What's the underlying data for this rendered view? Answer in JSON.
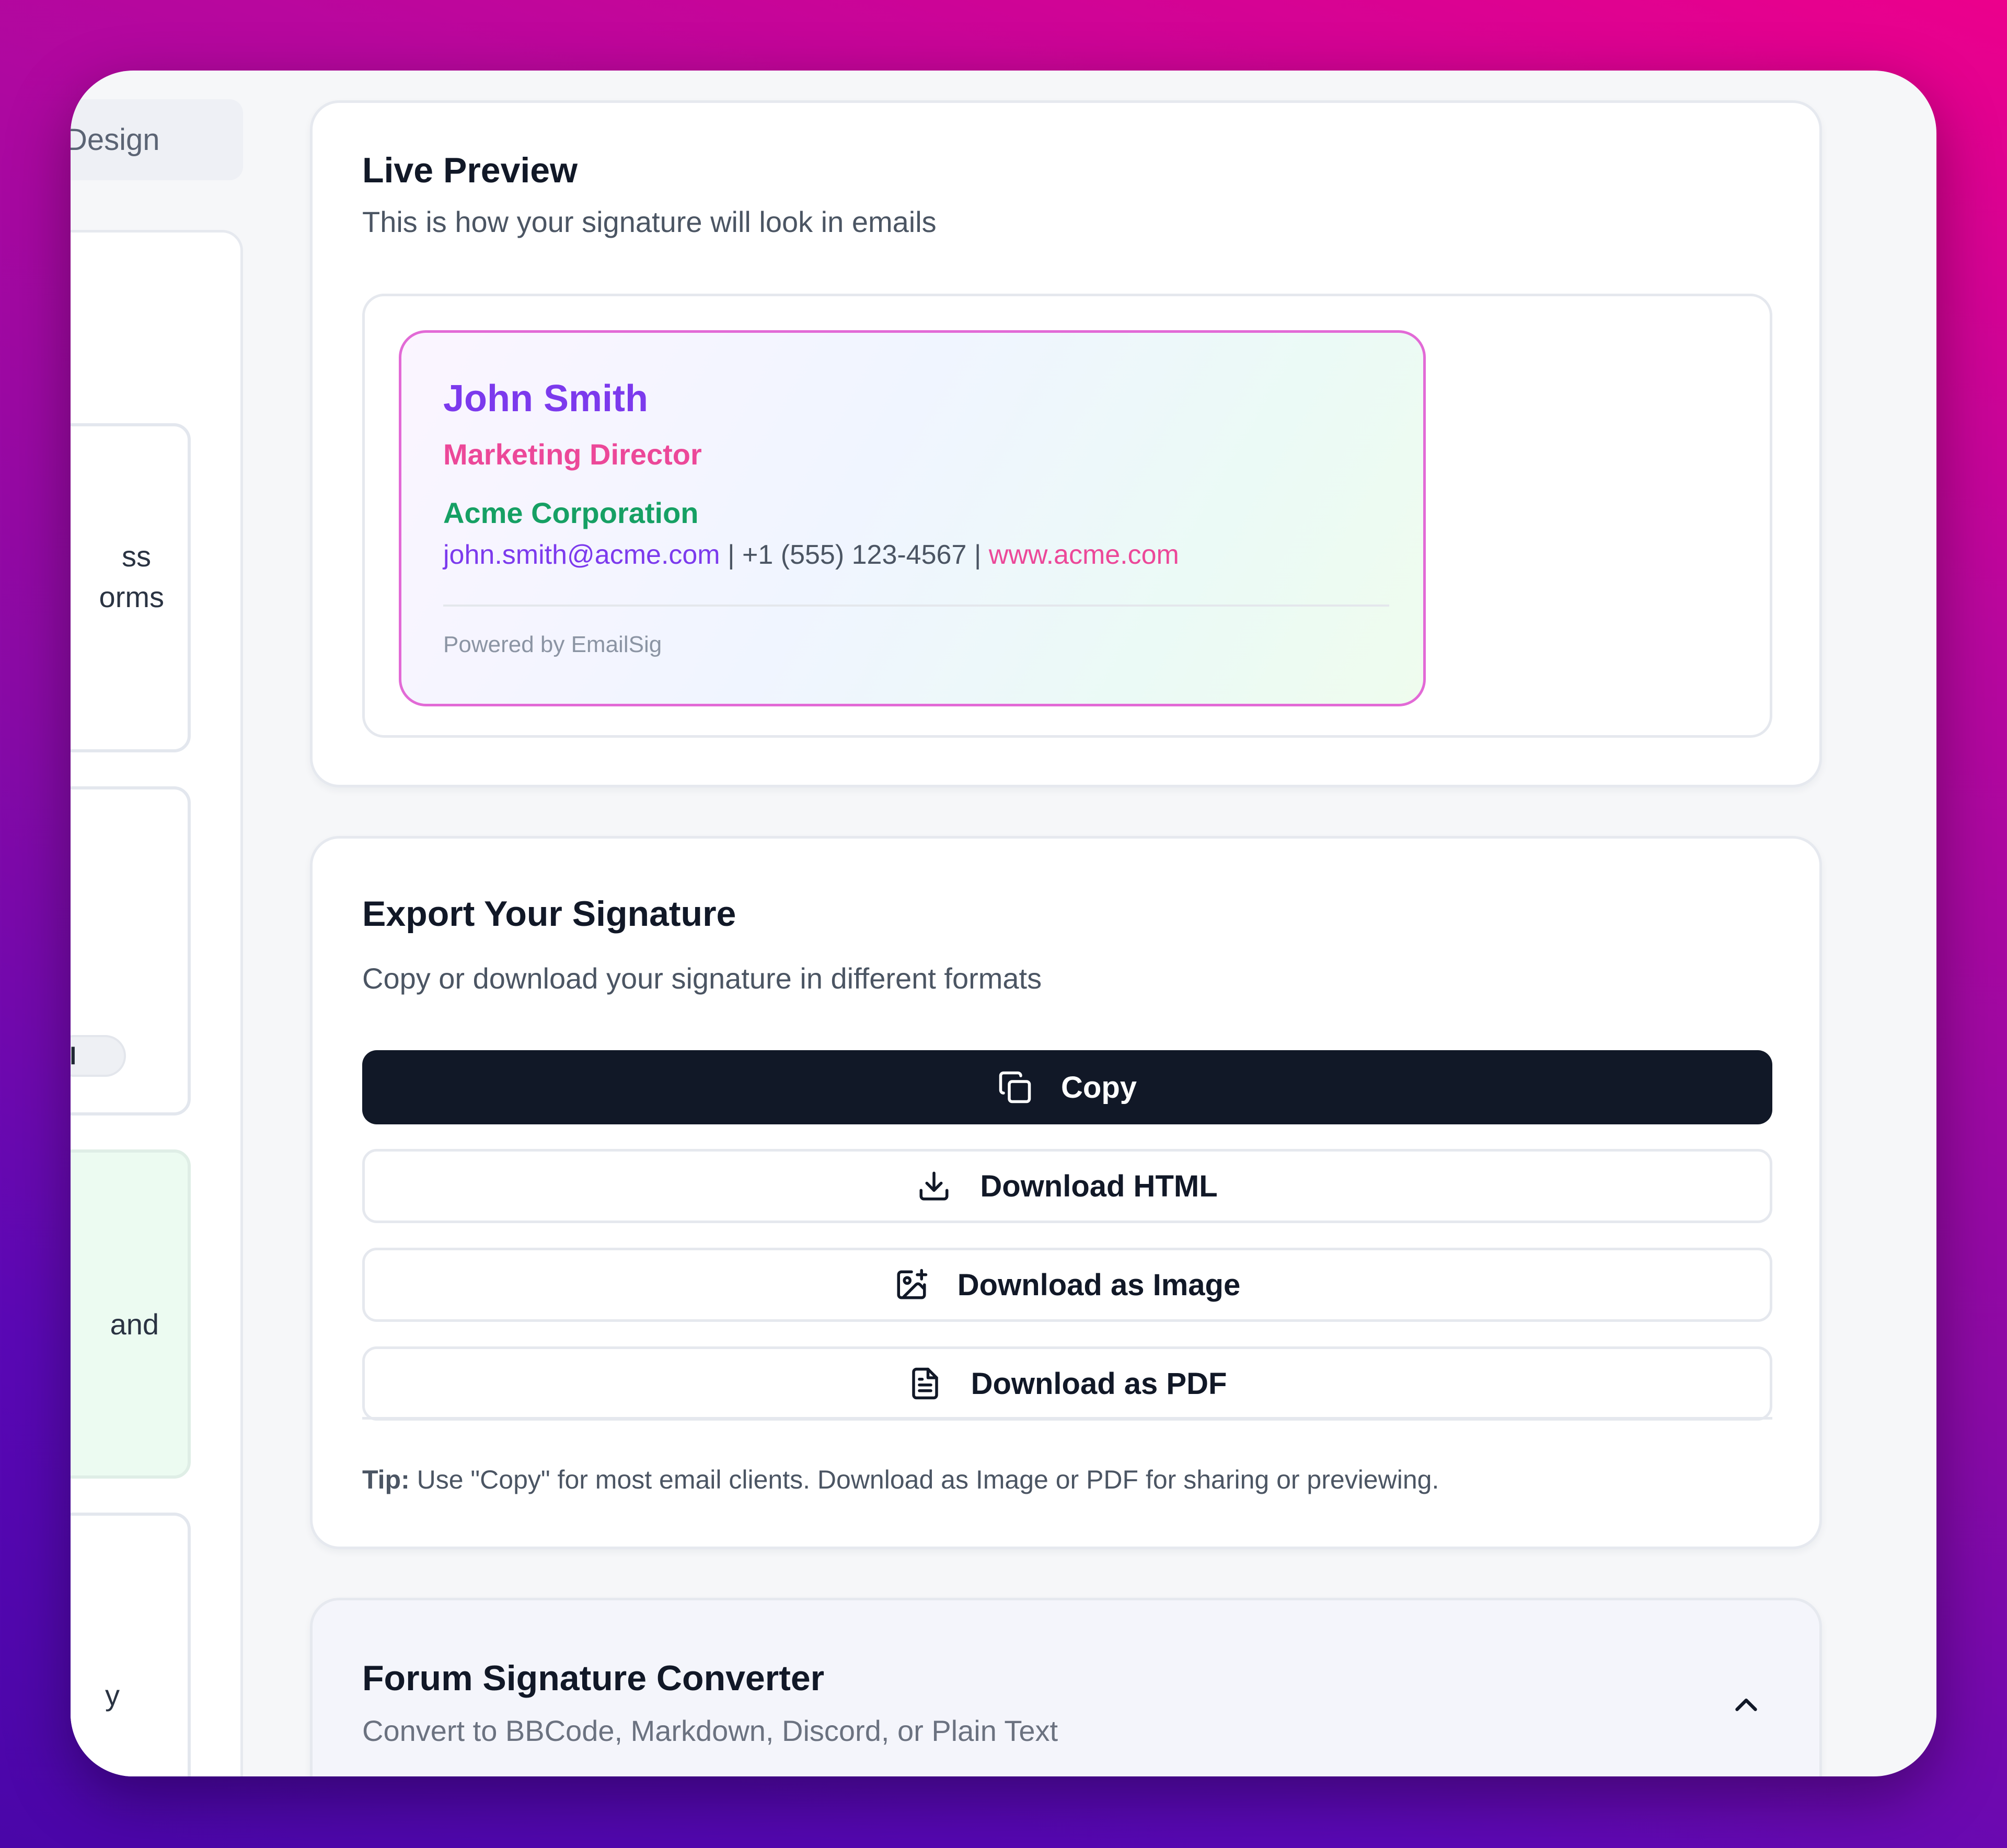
{
  "sidebar": {
    "design_tab": "Design",
    "cards": [
      {
        "text_line1": "ss",
        "text_line2": "orms"
      },
      {
        "badge": "ial"
      },
      {
        "text": "and"
      },
      {
        "text": "y"
      }
    ]
  },
  "preview": {
    "title": "Live Preview",
    "subtitle": "This is how your signature will look in emails",
    "signature": {
      "name": "John Smith",
      "job_title": "Marketing Director",
      "company": "Acme Corporation",
      "email": "john.smith@acme.com",
      "separator1": " | ",
      "phone": "+1 (555) 123-4567",
      "separator2": " | ",
      "website": "www.acme.com",
      "powered_by": "Powered by EmailSig"
    },
    "colors": {
      "name": "#7c3aed",
      "title": "#ec4899",
      "company": "#16a064",
      "border": "#e26ad6"
    }
  },
  "export": {
    "title": "Export Your Signature",
    "subtitle": "Copy or download your signature in different formats",
    "buttons": [
      {
        "label": "Copy",
        "icon": "copy-icon"
      },
      {
        "label": "Download HTML",
        "icon": "download-icon"
      },
      {
        "label": "Download as Image",
        "icon": "image-icon"
      },
      {
        "label": "Download as PDF",
        "icon": "file-text-icon"
      }
    ],
    "tip_label": "Tip:",
    "tip_text": " Use \"Copy\" for most email clients. Download as Image or PDF for sharing or previewing."
  },
  "forum": {
    "title": "Forum Signature Converter",
    "subtitle": "Convert to BBCode, Markdown, Discord, or Plain Text",
    "icon": "chevron-up-icon"
  }
}
